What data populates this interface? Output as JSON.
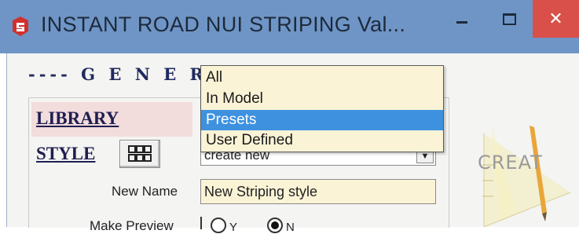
{
  "window": {
    "title": "INSTANT ROAD NUI STRIPING  Val...",
    "minimize_glyph": "−",
    "close_glyph": "✕"
  },
  "general": {
    "section_title": "---- G E N E R A",
    "library_label": "LIBRARY",
    "style_label": "STYLE",
    "style_select_value": "create new",
    "new_name_label": "New Name",
    "new_name_value": "New Striping style",
    "make_preview_label": "Make Preview",
    "preview_options": [
      "Y",
      "N"
    ],
    "preview_selected": "N"
  },
  "library_dropdown": {
    "options": [
      "All",
      "In Model",
      "Presets",
      "User Defined"
    ],
    "highlighted": "Presets"
  },
  "logo": {
    "text": "CREAT"
  },
  "icons": {
    "app": "sketchup-app-icon",
    "grid": "grid-icon",
    "dropdown": "chevron-down-icon"
  },
  "colors": {
    "titlebar": "#6f95c7",
    "close": "#d9504a",
    "highlight": "#3d91df",
    "dropdown_bg": "#fbf3d6",
    "heading": "#202a5e"
  }
}
